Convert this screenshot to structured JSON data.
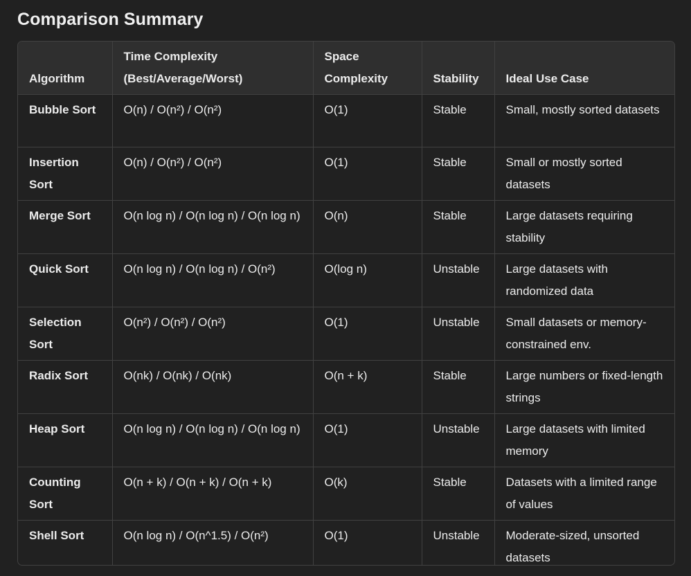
{
  "heading": "Comparison Summary",
  "table": {
    "headers": [
      "Algorithm",
      "Time Complexity (Best/Average/Worst)",
      "Space Complexity",
      "Stability",
      "Ideal Use Case"
    ],
    "rows": [
      [
        "Bubble Sort",
        "O(n) / O(n²) / O(n²)",
        "O(1)",
        "Stable",
        "Small, mostly sorted datasets"
      ],
      [
        "Insertion Sort",
        "O(n) / O(n²) / O(n²)",
        "O(1)",
        "Stable",
        "Small or mostly sorted datasets"
      ],
      [
        "Merge Sort",
        "O(n log n) / O(n log n) / O(n log n)",
        "O(n)",
        "Stable",
        "Large datasets requiring stability"
      ],
      [
        "Quick Sort",
        "O(n log n) / O(n log n) / O(n²)",
        "O(log n)",
        "Unstable",
        "Large datasets with randomized data"
      ],
      [
        "Selection Sort",
        "O(n²) / O(n²) / O(n²)",
        "O(1)",
        "Unstable",
        "Small datasets or memory-constrained env."
      ],
      [
        "Radix Sort",
        "O(nk) / O(nk) / O(nk)",
        "O(n + k)",
        "Stable",
        "Large numbers or fixed-length strings"
      ],
      [
        "Heap Sort",
        "O(n log n) / O(n log n) / O(n log n)",
        "O(1)",
        "Unstable",
        "Large datasets with limited memory"
      ],
      [
        "Counting Sort",
        "O(n + k) / O(n + k) / O(n + k)",
        "O(k)",
        "Stable",
        "Datasets with a limited range of values"
      ],
      [
        "Shell Sort",
        "O(n log n) / O(n^1.5) / O(n²)",
        "O(1)",
        "Unstable",
        "Moderate-sized, unsorted datasets"
      ]
    ]
  }
}
